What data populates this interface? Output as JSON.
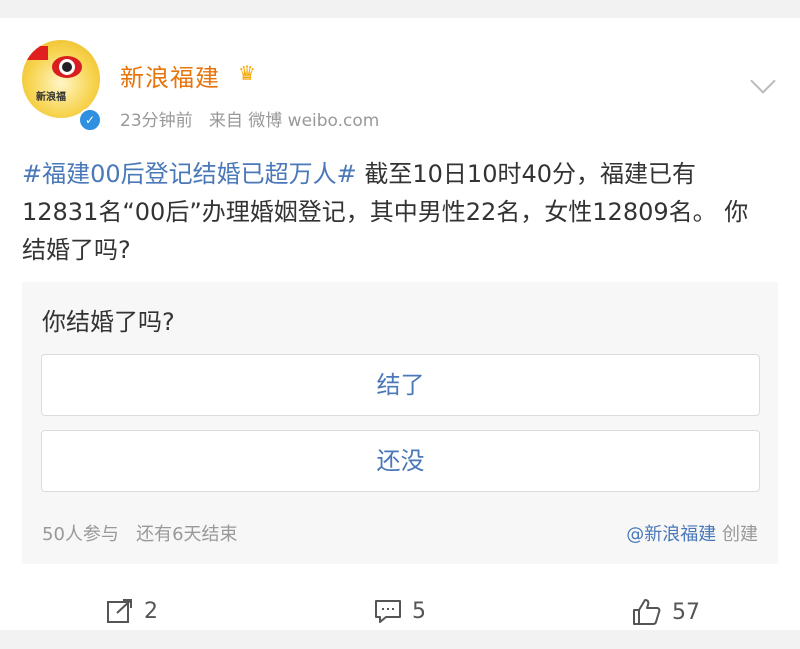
{
  "post": {
    "username": "新浪福建",
    "avatar_text": "新浪福",
    "time": "23分钟前",
    "source_prefix": "来自",
    "source": "微博 weibo.com",
    "hashtag": "#福建00后登记结婚已超万人#",
    "body": " 截至10日10时40分，福建已有12831名“00后”办理婚姻登记，其中男性22名，女性12809名。 你结婚了吗?"
  },
  "poll": {
    "question": "你结婚了吗?",
    "options": [
      "结了",
      "还没"
    ],
    "participants": "50人参与",
    "remaining": "还有6天结束",
    "creator_mention": "@新浪福建",
    "creator_suffix": "创建"
  },
  "actions": {
    "repost_count": "2",
    "comment_count": "5",
    "like_count": "57"
  },
  "colors": {
    "username": "#e8740c",
    "link": "#4a78b8",
    "muted": "#999999"
  },
  "icons": [
    "flag-icon",
    "crown-icon",
    "verified-icon",
    "chevron-down-icon",
    "repost-icon",
    "comment-icon",
    "like-icon"
  ]
}
